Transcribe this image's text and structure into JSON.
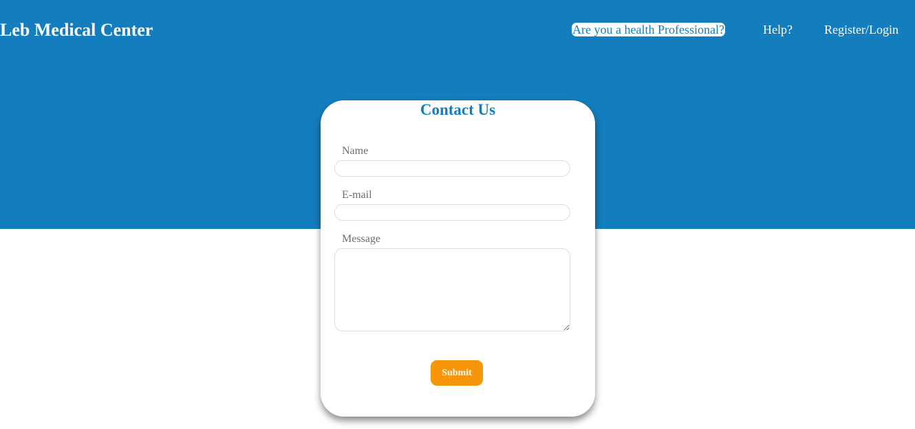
{
  "header": {
    "brand": "Leb Medical Center",
    "nav": {
      "professional": "Are you a health Professional?",
      "help": "Help?",
      "register_login": "Register/Login"
    }
  },
  "contact_form": {
    "title": "Contact Us",
    "name_label": "Name",
    "name_value": "",
    "email_label": "E-mail",
    "email_value": "",
    "message_label": "Message",
    "message_value": "",
    "submit_label": "Submit"
  },
  "colors": {
    "primary_blue": "#147dbe",
    "accent_orange": "#f7960a",
    "label_gray": "#6f6f6f"
  }
}
